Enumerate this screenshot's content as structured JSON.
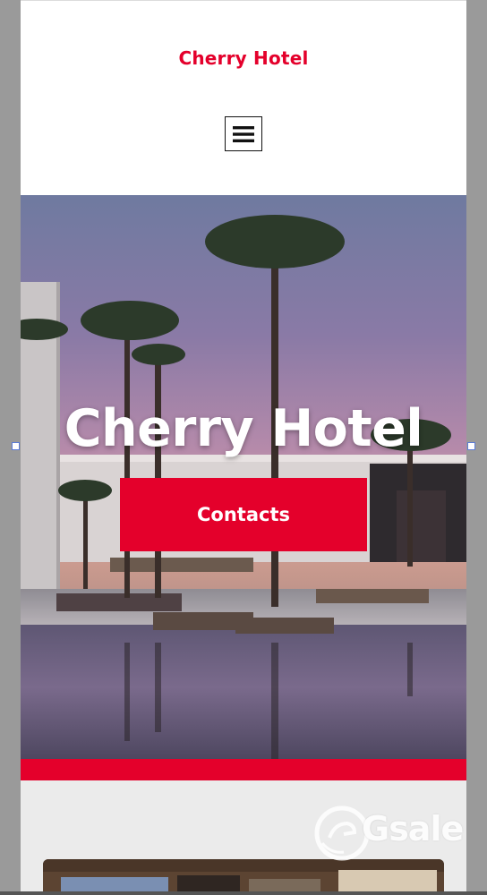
{
  "header": {
    "brand": "Cherry Hotel",
    "menu_icon": "hamburger-menu-icon"
  },
  "hero": {
    "title": "Cherry Hotel",
    "button_label": "Contacts"
  },
  "watermark": {
    "text": "Gsale",
    "icon": "gsale-logo-icon"
  },
  "colors": {
    "accent": "#e4002b",
    "page_background": "#ffffff",
    "section_background": "#ebebeb"
  }
}
